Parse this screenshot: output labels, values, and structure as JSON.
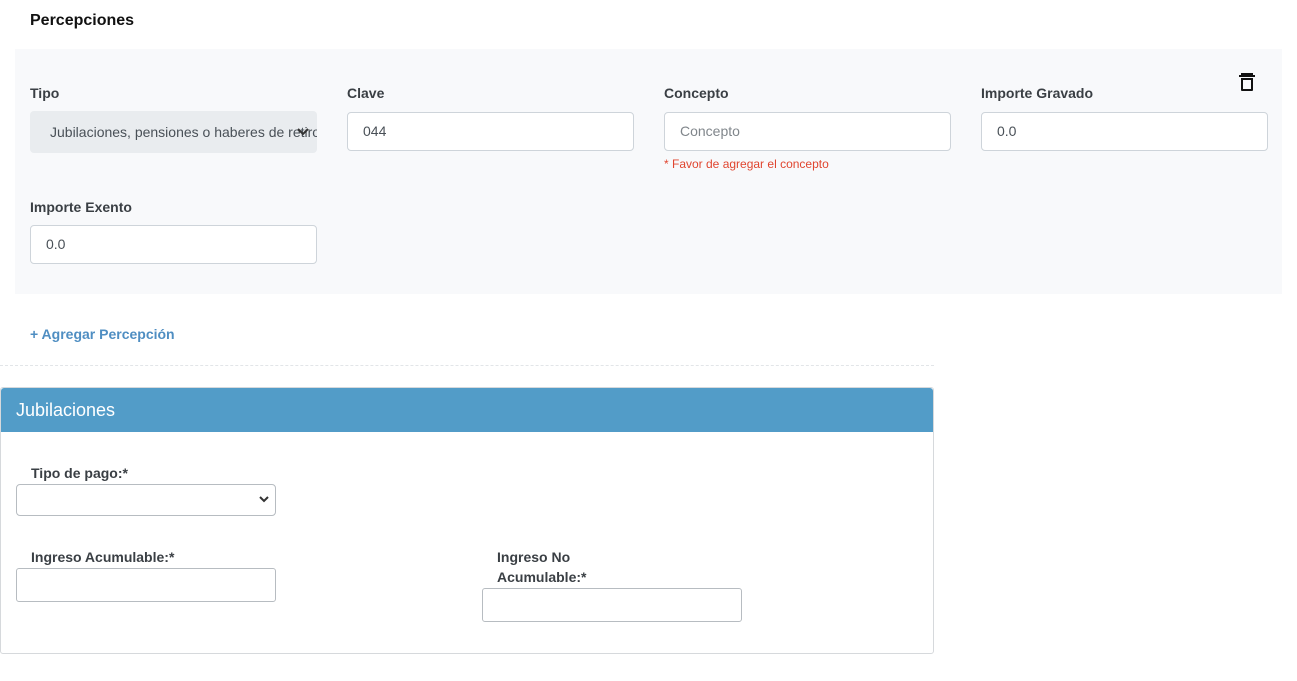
{
  "percepciones": {
    "title": "Percepciones",
    "fields": {
      "tipo_label": "Tipo",
      "tipo_value": "Jubilaciones, pensiones o haberes de retiro",
      "clave_label": "Clave",
      "clave_value": "044",
      "concepto_label": "Concepto",
      "concepto_placeholder": "Concepto",
      "concepto_error": "* Favor de agregar el concepto",
      "importe_gravado_label": "Importe Gravado",
      "importe_gravado_value": "0.0",
      "importe_exento_label": "Importe Exento",
      "importe_exento_value": "0.0"
    },
    "delete_icon": "trash-icon",
    "add_link": "+ Agregar Percepción"
  },
  "jubilaciones": {
    "header": "Jubilaciones",
    "tipo_pago_label": "Tipo de pago:*",
    "tipo_pago_value": "",
    "ingreso_acumulable_label": "Ingreso Acumulable:*",
    "ingreso_acumulable_value": "",
    "ingreso_no_acumulable_label_line1": "Ingreso No",
    "ingreso_no_acumulable_label_line2": "Acumulable:*",
    "ingreso_no_acumulable_value": ""
  },
  "colors": {
    "accent": "#529cc8",
    "link": "#4f8ec2",
    "error": "#e0452f",
    "panel_bg": "#f8f9fb"
  }
}
